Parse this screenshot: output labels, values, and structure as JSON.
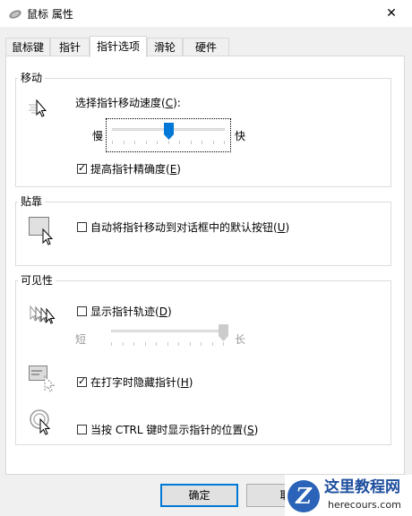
{
  "window": {
    "title": "鼠标 属性",
    "close_glyph": "✕"
  },
  "tabs": [
    {
      "label": "鼠标键",
      "active": false
    },
    {
      "label": "指针",
      "active": false
    },
    {
      "label": "指针选项",
      "active": true
    },
    {
      "label": "滑轮",
      "active": false
    },
    {
      "label": "硬件",
      "active": false
    }
  ],
  "motion": {
    "title": "移动",
    "speed_label": "选择指针移动速度(",
    "speed_key": "C",
    "speed_suffix": "):",
    "slow": "慢",
    "fast": "快",
    "speed_level": 0.5,
    "precision_label": "提高指针精确度(",
    "precision_key": "E",
    "precision_suffix": ")",
    "precision_checked": true
  },
  "snap": {
    "title": "贴靠",
    "label": "自动将指针移动到对话框中的默认按钮(",
    "key": "U",
    "suffix": ")",
    "checked": false
  },
  "visibility": {
    "title": "可见性",
    "trails_label": "显示指针轨迹(",
    "trails_key": "D",
    "trails_suffix": ")",
    "trails_checked": false,
    "short": "短",
    "long": "长",
    "trails_level": 1.0,
    "hide_label": "在打字时隐藏指针(",
    "hide_key": "H",
    "hide_suffix": ")",
    "hide_checked": true,
    "ctrl_label": "当按 CTRL 键时显示指针的位置(",
    "ctrl_key": "S",
    "ctrl_suffix": ")",
    "ctrl_checked": false
  },
  "buttons": {
    "ok": "确定",
    "cancel": "取"
  },
  "watermark": {
    "text": "这里教程网",
    "url": "herecours.com",
    "letter": "Z"
  },
  "checkmark": "✓"
}
